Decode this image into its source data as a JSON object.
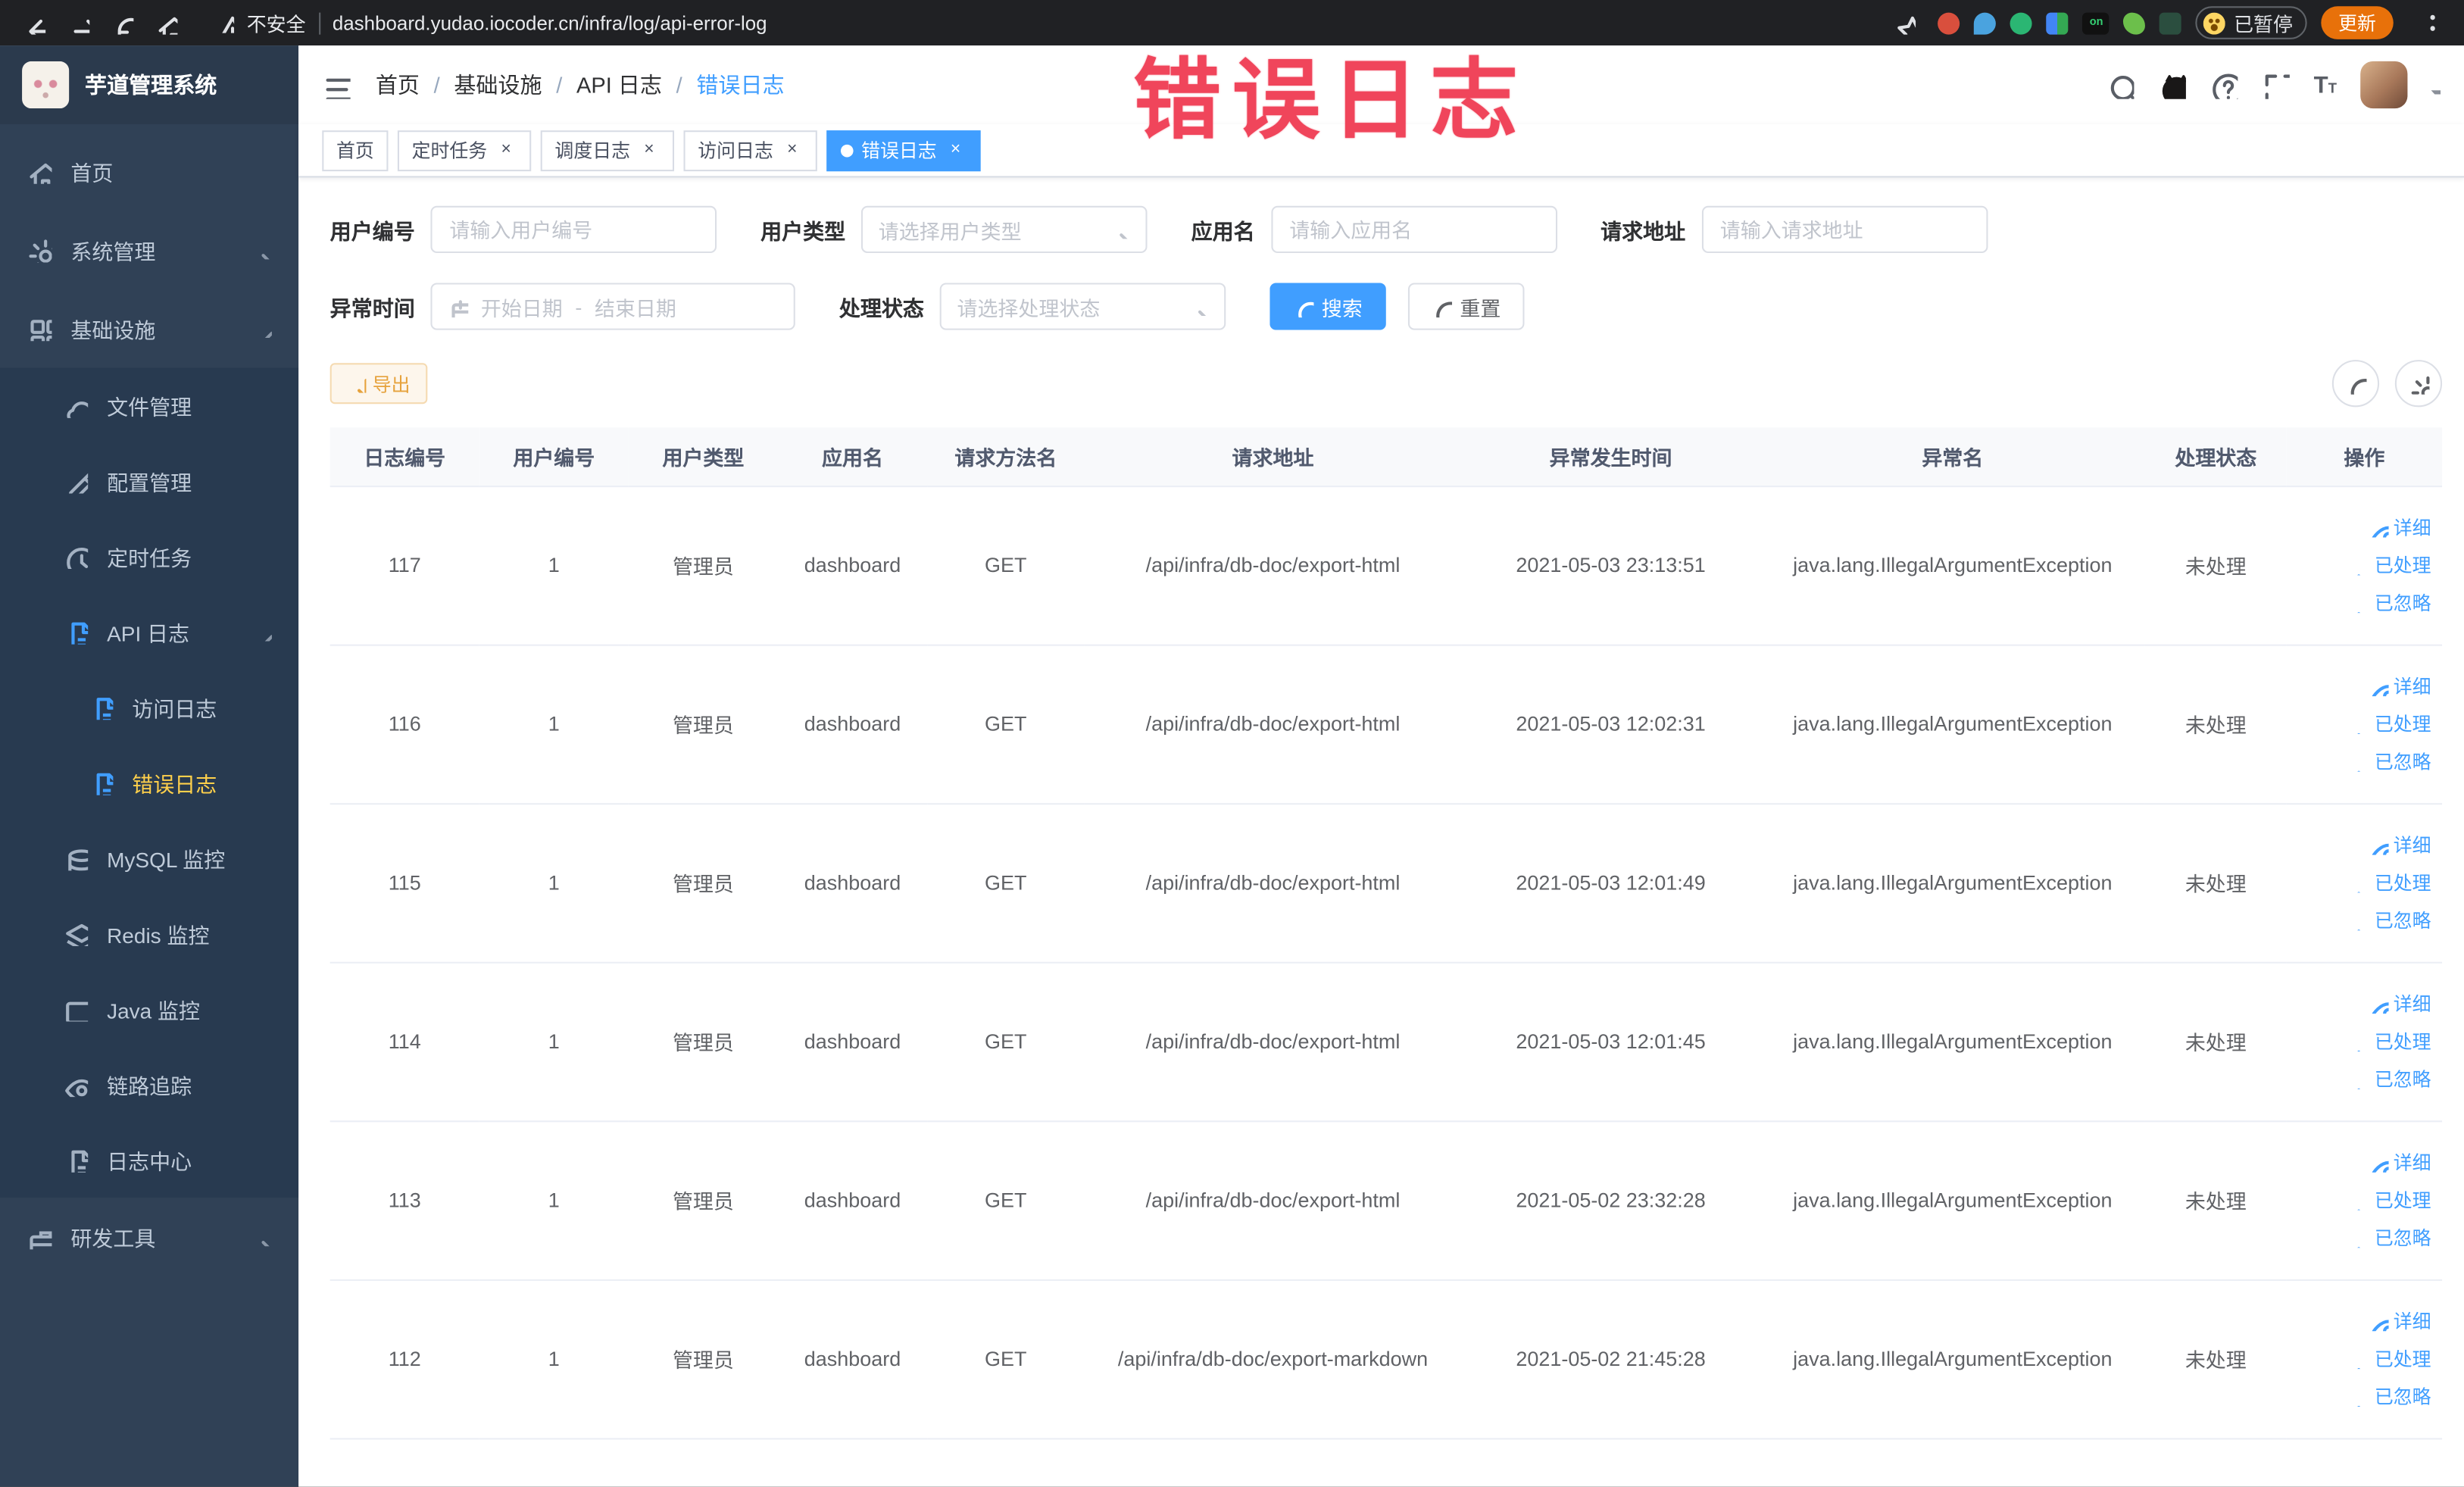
{
  "browser": {
    "security_label": "不安全",
    "url": "dashboard.yudao.iocoder.cn/infra/log/api-error-log",
    "paused_label": "已暂停",
    "update_label": "更新"
  },
  "watermark": "错误日志",
  "sidebar": {
    "title": "芋道管理系统",
    "menu": [
      {
        "label": "首页"
      },
      {
        "label": "系统管理"
      },
      {
        "label": "基础设施"
      },
      {
        "label": "文件管理"
      },
      {
        "label": "配置管理"
      },
      {
        "label": "定时任务"
      },
      {
        "label": "API 日志"
      },
      {
        "label": "访问日志"
      },
      {
        "label": "错误日志"
      },
      {
        "label": "MySQL 监控"
      },
      {
        "label": "Redis 监控"
      },
      {
        "label": "Java 监控"
      },
      {
        "label": "链路追踪"
      },
      {
        "label": "日志中心"
      },
      {
        "label": "研发工具"
      }
    ]
  },
  "navbar": {
    "breadcrumb": [
      "首页",
      "基础设施",
      "API 日志",
      "错误日志"
    ],
    "separator": "/"
  },
  "tags": [
    {
      "label": "首页"
    },
    {
      "label": "定时任务"
    },
    {
      "label": "调度日志"
    },
    {
      "label": "访问日志"
    },
    {
      "label": "错误日志"
    }
  ],
  "filters": {
    "user_id": {
      "label": "用户编号",
      "placeholder": "请输入用户编号"
    },
    "user_type": {
      "label": "用户类型",
      "placeholder": "请选择用户类型"
    },
    "app_name": {
      "label": "应用名",
      "placeholder": "请输入应用名"
    },
    "request_url": {
      "label": "请求地址",
      "placeholder": "请输入请求地址"
    },
    "exception_time": {
      "label": "异常时间",
      "start_placeholder": "开始日期",
      "separator": "-",
      "end_placeholder": "结束日期"
    },
    "process_status": {
      "label": "处理状态",
      "placeholder": "请选择处理状态"
    },
    "search_label": "搜索",
    "reset_label": "重置"
  },
  "toolbar": {
    "export_label": "导出"
  },
  "table": {
    "headers": [
      "日志编号",
      "用户编号",
      "用户类型",
      "应用名",
      "请求方法名",
      "请求地址",
      "异常发生时间",
      "异常名",
      "处理状态",
      "操作"
    ],
    "action_labels": [
      "详细",
      "已处理",
      "已忽略"
    ],
    "rows": [
      {
        "id": "117",
        "user_id": "1",
        "user_type": "管理员",
        "app": "dashboard",
        "method": "GET",
        "url": "/api/infra/db-doc/export-html",
        "time": "2021-05-03 23:13:51",
        "exception": "java.lang.IllegalArgumentException",
        "status": "未处理"
      },
      {
        "id": "116",
        "user_id": "1",
        "user_type": "管理员",
        "app": "dashboard",
        "method": "GET",
        "url": "/api/infra/db-doc/export-html",
        "time": "2021-05-03 12:02:31",
        "exception": "java.lang.IllegalArgumentException",
        "status": "未处理"
      },
      {
        "id": "115",
        "user_id": "1",
        "user_type": "管理员",
        "app": "dashboard",
        "method": "GET",
        "url": "/api/infra/db-doc/export-html",
        "time": "2021-05-03 12:01:49",
        "exception": "java.lang.IllegalArgumentException",
        "status": "未处理"
      },
      {
        "id": "114",
        "user_id": "1",
        "user_type": "管理员",
        "app": "dashboard",
        "method": "GET",
        "url": "/api/infra/db-doc/export-html",
        "time": "2021-05-03 12:01:45",
        "exception": "java.lang.IllegalArgumentException",
        "status": "未处理"
      },
      {
        "id": "113",
        "user_id": "1",
        "user_type": "管理员",
        "app": "dashboard",
        "method": "GET",
        "url": "/api/infra/db-doc/export-html",
        "time": "2021-05-02 23:32:28",
        "exception": "java.lang.IllegalArgumentException",
        "status": "未处理"
      },
      {
        "id": "112",
        "user_id": "1",
        "user_type": "管理员",
        "app": "dashboard",
        "method": "GET",
        "url": "/api/infra/db-doc/export-markdown",
        "time": "2021-05-02 21:45:28",
        "exception": "java.lang.IllegalArgumentException",
        "status": "未处理"
      }
    ]
  }
}
